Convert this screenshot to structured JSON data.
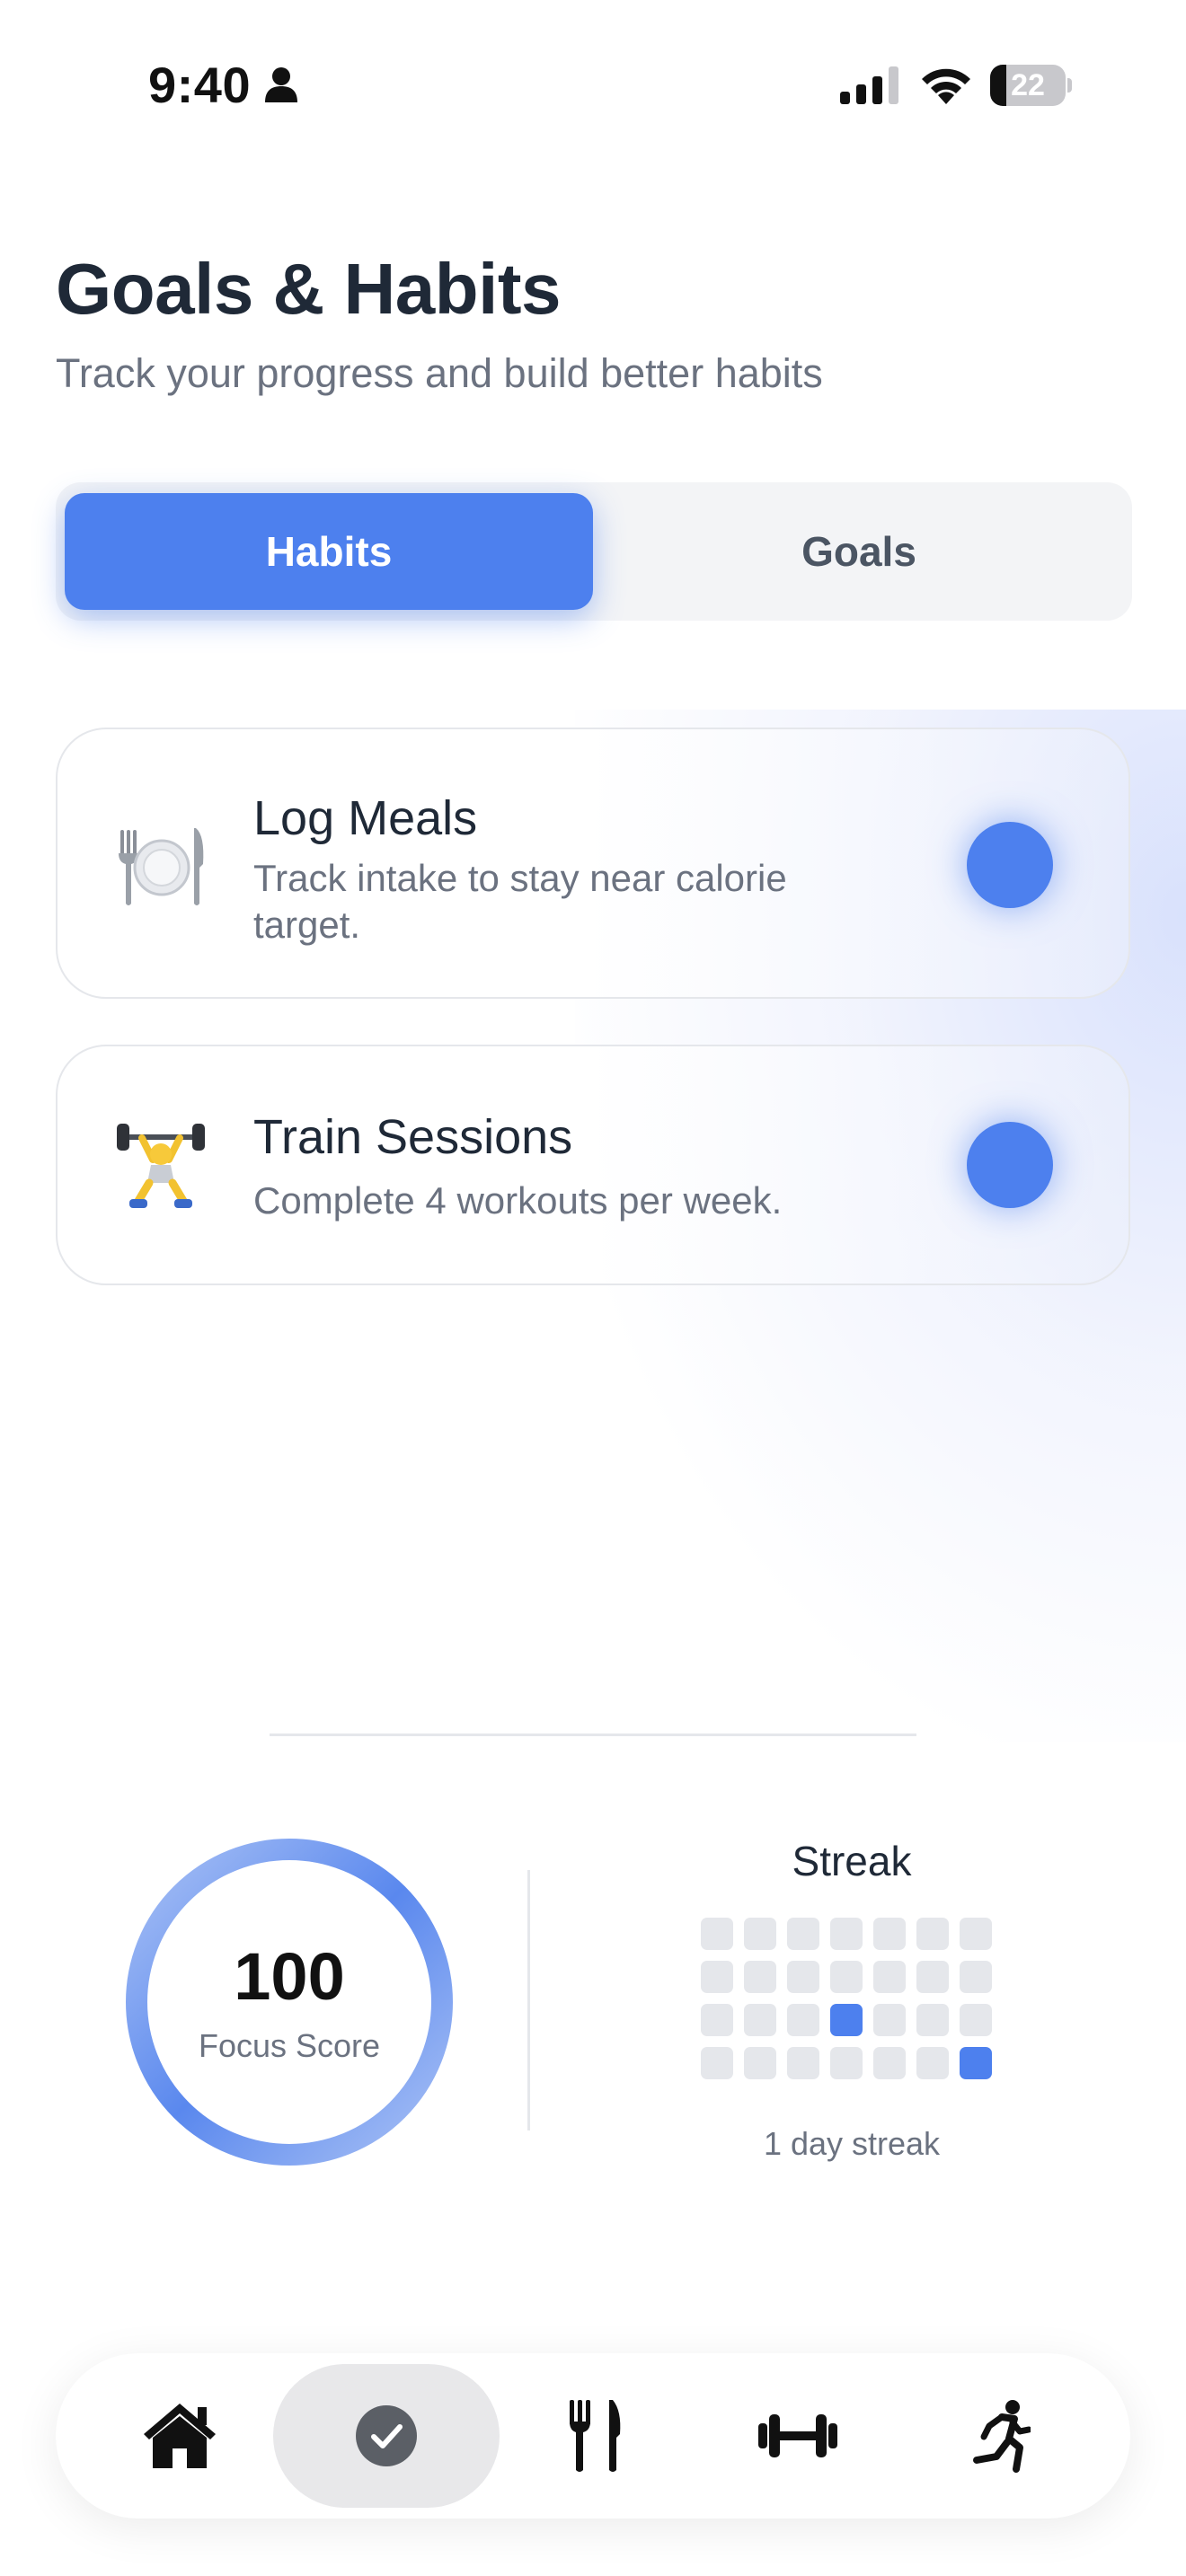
{
  "status_bar": {
    "time": "9:40",
    "battery": "22",
    "battery_percent": 22
  },
  "header": {
    "title": "Goals & Habits",
    "subtitle": "Track your progress and build better habits"
  },
  "tabs": {
    "active": "Habits",
    "items": [
      {
        "label": "Habits"
      },
      {
        "label": "Goals"
      }
    ]
  },
  "habits": [
    {
      "icon": "plate-fork-knife-icon",
      "title": "Log Meals",
      "description": "Track intake to stay near calorie target.",
      "completed": true
    },
    {
      "icon": "weightlifter-icon",
      "title": "Train Sessions",
      "description": "Complete 4 workouts per week.",
      "completed": true
    }
  ],
  "focus": {
    "score": "100",
    "label": "Focus Score"
  },
  "streak": {
    "title": "Streak",
    "caption": "1 day streak",
    "grid": [
      [
        0,
        0,
        0,
        0,
        0,
        0,
        0
      ],
      [
        0,
        0,
        0,
        0,
        0,
        0,
        0
      ],
      [
        0,
        0,
        0,
        1,
        0,
        0,
        0
      ],
      [
        0,
        0,
        0,
        0,
        0,
        0,
        1
      ]
    ]
  },
  "bottom_nav": {
    "active": "habits",
    "items": [
      {
        "id": "home",
        "icon": "home-icon"
      },
      {
        "id": "habits",
        "icon": "check-circle-icon"
      },
      {
        "id": "meals",
        "icon": "fork-knife-icon"
      },
      {
        "id": "workouts",
        "icon": "dumbbell-icon"
      },
      {
        "id": "run",
        "icon": "running-figure-icon"
      }
    ]
  },
  "colors": {
    "accent": "#4d80ee",
    "text_primary": "#1f2937",
    "text_secondary": "#6b7280",
    "streak_empty": "#e5e7eb"
  }
}
